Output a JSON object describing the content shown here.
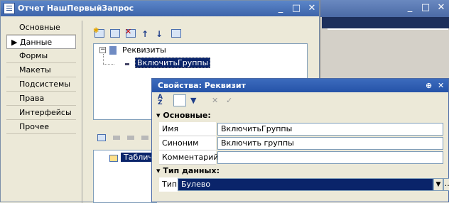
{
  "main_window": {
    "title": "Отчет НашПервыйЗапрос",
    "controls": [
      "_",
      "□",
      "✕"
    ]
  },
  "sidebar": {
    "items": [
      {
        "label": "Основные"
      },
      {
        "label": "Данные"
      },
      {
        "label": "Формы"
      },
      {
        "label": "Макеты"
      },
      {
        "label": "Подсистемы"
      },
      {
        "label": "Права"
      },
      {
        "label": "Интерфейсы"
      },
      {
        "label": "Прочее"
      }
    ],
    "active_index": 1
  },
  "tree": {
    "root_label": "Реквизиты",
    "child_label": "ВключитьГруппы",
    "lower_item_label": "Табличн"
  },
  "bg_window": {
    "controls": [
      "_",
      "□",
      "✕"
    ]
  },
  "properties": {
    "title": "Свойства: Реквизит",
    "title_controls": [
      "⊕",
      "✕"
    ],
    "section_main": "Основные:",
    "rows": [
      {
        "label": "Имя",
        "value": "ВключитьГруппы"
      },
      {
        "label": "Синоним",
        "value": "Включить группы"
      },
      {
        "label": "Комментарий",
        "value": ""
      }
    ],
    "section_type": "Тип данных:",
    "type_row": {
      "label": "Тип",
      "value": "Булево"
    }
  }
}
